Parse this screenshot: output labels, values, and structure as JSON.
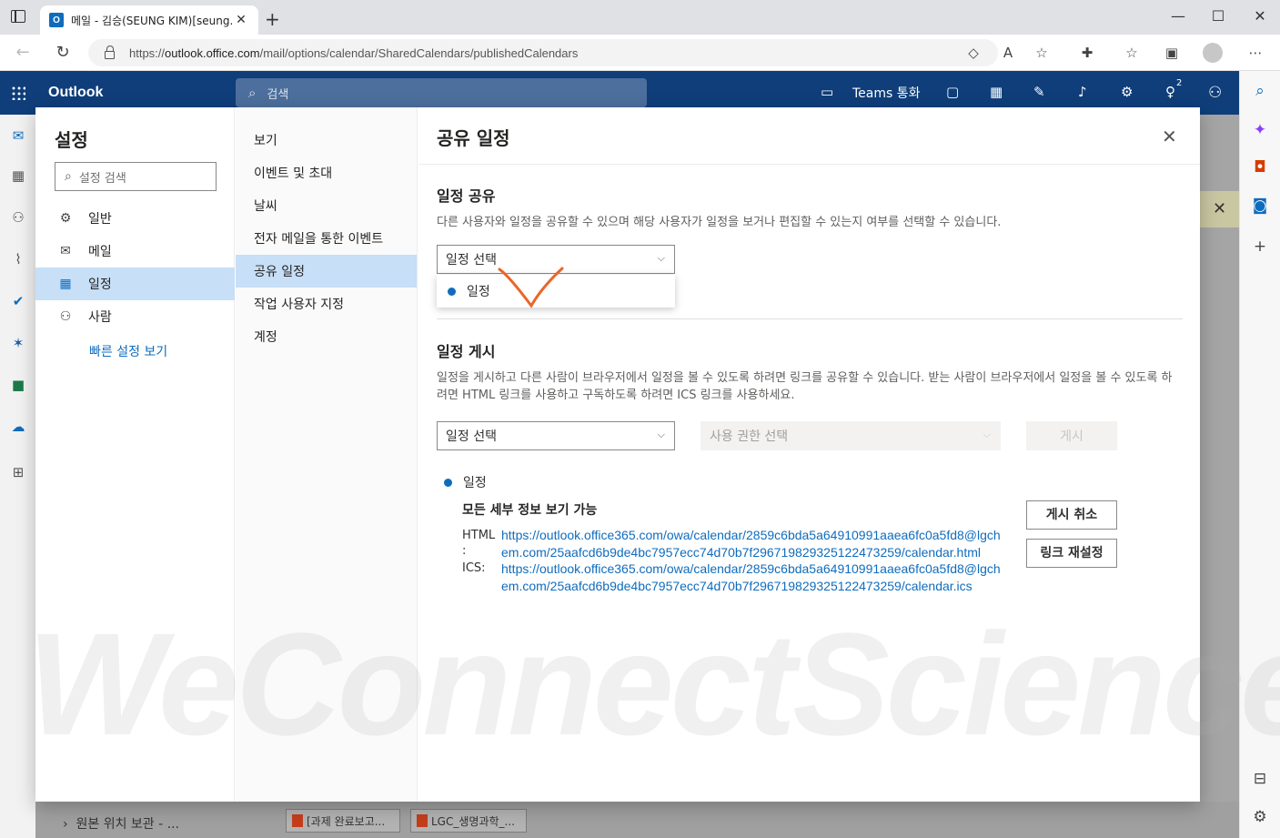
{
  "browser": {
    "tab_title": "메일 - 김승(SEUNG KIM)[seung.k",
    "tab_favicon": "O",
    "url_prefix": "https://",
    "url_host": "outlook.office.com",
    "url_path": "/mail/options/calendar/SharedCalendars/publishedCalendars"
  },
  "outlook": {
    "brand": "Outlook",
    "search_placeholder": "검색",
    "teams_call": "Teams 통화",
    "tips_badge": "2",
    "bottom_folder": "원본 위치 보관 - ...",
    "attachments": [
      "[과제 완료보고...",
      "LGC_생명과학_..."
    ]
  },
  "settings": {
    "title": "설정",
    "search_placeholder": "설정 검색",
    "categories": [
      {
        "label": "일반",
        "icon": "gear-icon"
      },
      {
        "label": "메일",
        "icon": "mail-icon"
      },
      {
        "label": "일정",
        "icon": "calendar-icon"
      },
      {
        "label": "사람",
        "icon": "people-icon"
      }
    ],
    "quick_settings": "빠른 설정 보기",
    "subcategories": [
      "보기",
      "이벤트 및 초대",
      "날씨",
      "전자 메일을 통한 이벤트",
      "공유 일정",
      "작업 사용자 지정",
      "계정"
    ]
  },
  "shared_calendars": {
    "title": "공유 일정",
    "share_heading": "일정 공유",
    "share_desc": "다른 사용자와 일정을 공유할 수 있으며 해당 사용자가 일정을 보거나 편집할 수 있는지 여부를 선택할 수 있습니다.",
    "share_select_placeholder": "일정 선택",
    "dropdown_option": "일정",
    "publish_heading": "일정 게시",
    "publish_desc": "일정을 게시하고 다른 사람이 브라우저에서 일정을 볼 수 있도록 하려면 링크를 공유할 수 있습니다. 받는 사람이 브라우저에서 일정을 볼 수 있도록 하려면 HTML 링크를 사용하고 구독하도록 하려면 ICS 링크를 사용하세요.",
    "publish_select_placeholder": "일정 선택",
    "permission_placeholder": "사용 권한 선택",
    "publish_button": "게시",
    "published_calendar": "일정",
    "permission_level": "모든 세부 정보 보기 가능",
    "html_label": "HTML\n:",
    "html_link": "https://outlook.office365.com/owa/calendar/2859c6bda5a64910991aaea6fc0a5fd8@lgchem.com/25aafcd6b9de4bc7957ecc74d70b7f29671982932512247325​9/calendar.html",
    "ics_label": "ICS:",
    "ics_link": "https://outlook.office365.com/owa/calendar/2859c6bda5a64910991aaea6fc0a5fd8@lgchem.com/25aafcd6b9de4bc7957ecc74d70b7f29671982932512247325​9/calendar.ics",
    "unpublish_button": "게시 취소",
    "reset_links_button": "링크 재설정"
  },
  "watermark": "WeConnectScience",
  "colors": {
    "accent": "#0f6cbd",
    "selected": "#c7dff7",
    "outlook_header": "#0f3e7a",
    "annotation": "#e8672a"
  }
}
